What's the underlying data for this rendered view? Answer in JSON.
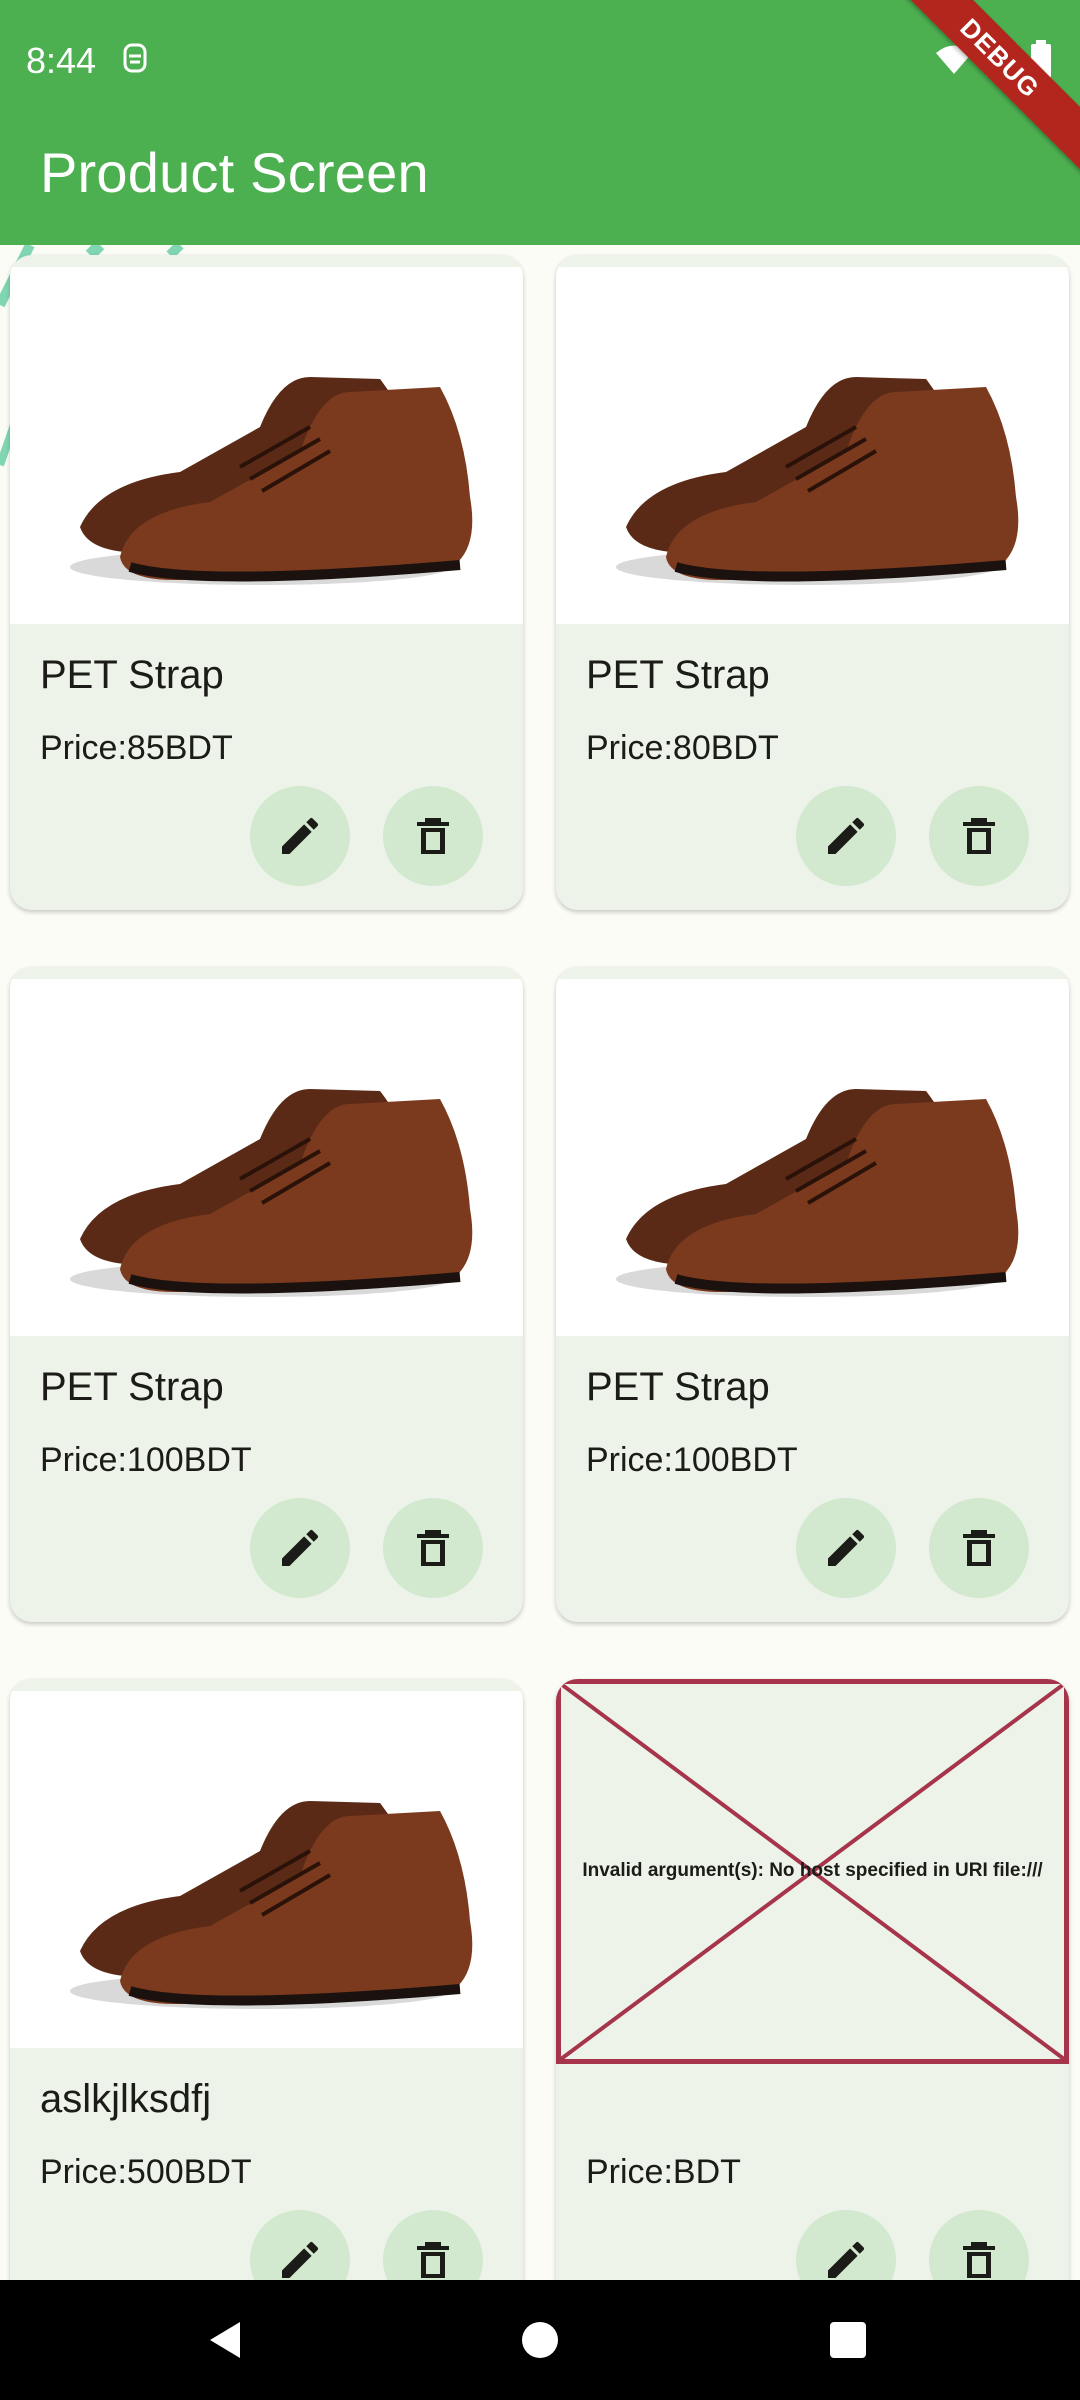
{
  "status_bar": {
    "time": "8:44",
    "icons": [
      "notification-icon",
      "wifi-icon",
      "signal-icon",
      "battery-icon"
    ]
  },
  "app_bar": {
    "title": "Product Screen",
    "background": "#4caf50"
  },
  "debug_banner": {
    "label": "DEBUG"
  },
  "products": [
    {
      "name": "PET Strap",
      "price": "Price:85BDT",
      "image": "brown-shoe"
    },
    {
      "name": "PET Strap",
      "price": "Price:80BDT",
      "image": "brown-shoe"
    },
    {
      "name": "PET Strap",
      "price": "Price:100BDT",
      "image": "brown-shoe"
    },
    {
      "name": "PET Strap",
      "price": "Price:100BDT",
      "image": "brown-shoe"
    },
    {
      "name": "aslkjlksdfj",
      "price": "Price:500BDT",
      "image": "brown-shoe"
    },
    {
      "name": "",
      "price": "Price:BDT",
      "image": "error",
      "error_text": "Invalid argument(s): No host specified in URI file:///"
    }
  ],
  "actions": {
    "edit_icon": "pencil-icon",
    "delete_icon": "trash-icon"
  },
  "colors": {
    "card": "#edf3e9",
    "fab": "#d2e8cf",
    "error_border": "#a6344a"
  },
  "nav_bar": {
    "icons": [
      "back-icon",
      "home-icon",
      "recents-icon"
    ]
  }
}
